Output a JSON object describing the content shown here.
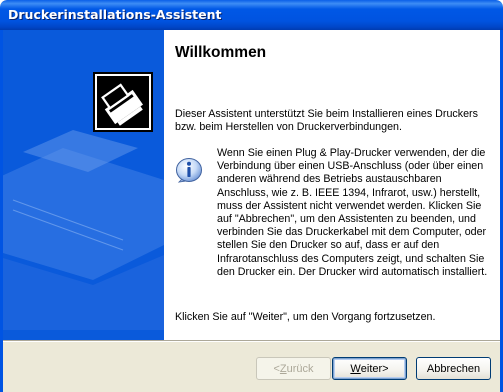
{
  "window": {
    "title": "Druckerinstallations-Assistent"
  },
  "page": {
    "heading": "Willkommen",
    "intro": "Dieser Assistent unterstützt Sie beim Installieren eines Druckers bzw. beim Herstellen von Druckerverbindungen.",
    "info": "Wenn Sie einen Plug & Play-Drucker verwenden, der die Verbindung über einen USB-Anschluss (oder über einen anderen während des Betriebs austauschbaren Anschluss, wie z. B. IEEE 1394, Infrarot, usw.) herstellt, muss der Assistent nicht verwendet werden. Klicken Sie auf \"Abbrechen\", um den Assistenten zu beenden, und verbinden Sie das Druckerkabel mit dem Computer, oder stellen Sie den Drucker so auf, dass er auf den Infrarotanschluss des Computers zeigt, und schalten Sie den Drucker ein. Der Drucker wird automatisch installiert.",
    "outro": "Klicken Sie auf \"Weiter\", um den Vorgang fortzusetzen."
  },
  "buttons": {
    "back": {
      "mnemonic": "Z",
      "rest": "urück",
      "prefix": "< "
    },
    "next": {
      "mnemonic": "W",
      "rest": "eiter",
      "suffix": " >"
    },
    "cancel": "Abbrechen"
  },
  "icons": {
    "logo": "printer-wizard-icon",
    "info": "information-icon"
  },
  "colors": {
    "title_bar": "#0054e3",
    "sidebar": "#0a5adb",
    "face": "#ece9d8"
  }
}
